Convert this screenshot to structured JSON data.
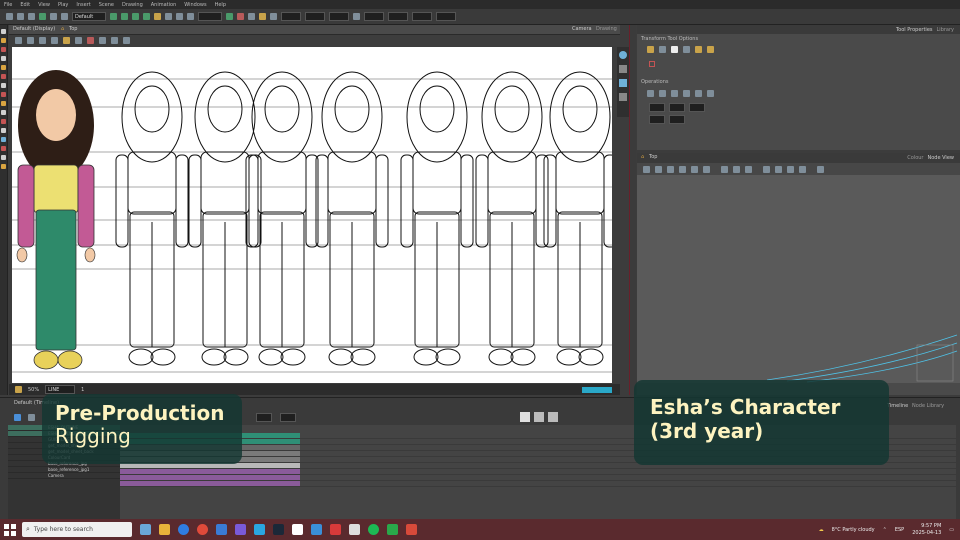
{
  "menu": [
    "File",
    "Edit",
    "View",
    "Play",
    "Insert",
    "Scene",
    "Drawing",
    "Animation",
    "Windows",
    "Help"
  ],
  "toolbar": {
    "preset": "Default"
  },
  "view": {
    "title": "Default (Display)",
    "tabs": [
      "Camera",
      "Drawing"
    ],
    "breadcrumb": "Top",
    "status": {
      "zoom": "50%",
      "frame": "1",
      "value": "1",
      "mode": "LINE"
    }
  },
  "tool_properties": {
    "tabs": [
      "Tool Properties",
      "Library"
    ],
    "section1": "Transform Tool Options",
    "section2": "Operations"
  },
  "node_view": {
    "breadcrumb": "Top",
    "tabs": [
      "Colour",
      "Node View"
    ]
  },
  "timeline": {
    "header": "Default (Timeline)",
    "tabs": [
      "Timeline",
      "Node Library"
    ],
    "layers": [
      "ESHA_OUTLINE",
      "ESHA_COLOUR",
      "GUIDELINE",
      "get_model_sheet",
      "get_model_sheet_back",
      "ColourCard",
      "base_reference_jpg",
      "base_reference_jpg1",
      "Camera"
    ]
  },
  "overlay_left": {
    "line1": "Pre-Production",
    "line2": "Rigging"
  },
  "overlay_right": {
    "line1": "Esha’s Character",
    "line2": "(3rd year)"
  },
  "taskbar": {
    "search_placeholder": "Type here to search",
    "weather": "8°C  Partly cloudy",
    "lang": "ESP",
    "time": "9:57 PM",
    "date": "2025-04-13"
  },
  "colors": {
    "hair": "#2e1e16",
    "skin": "#f2c9a6",
    "shirt": "#ece072",
    "sleeve": "#c25a95",
    "pants": "#2e8a6a",
    "shoes": "#e8d15a",
    "overlay": "#143732",
    "overlay_text": "#fdf3c0",
    "taskbar": "#5a2a2e"
  }
}
